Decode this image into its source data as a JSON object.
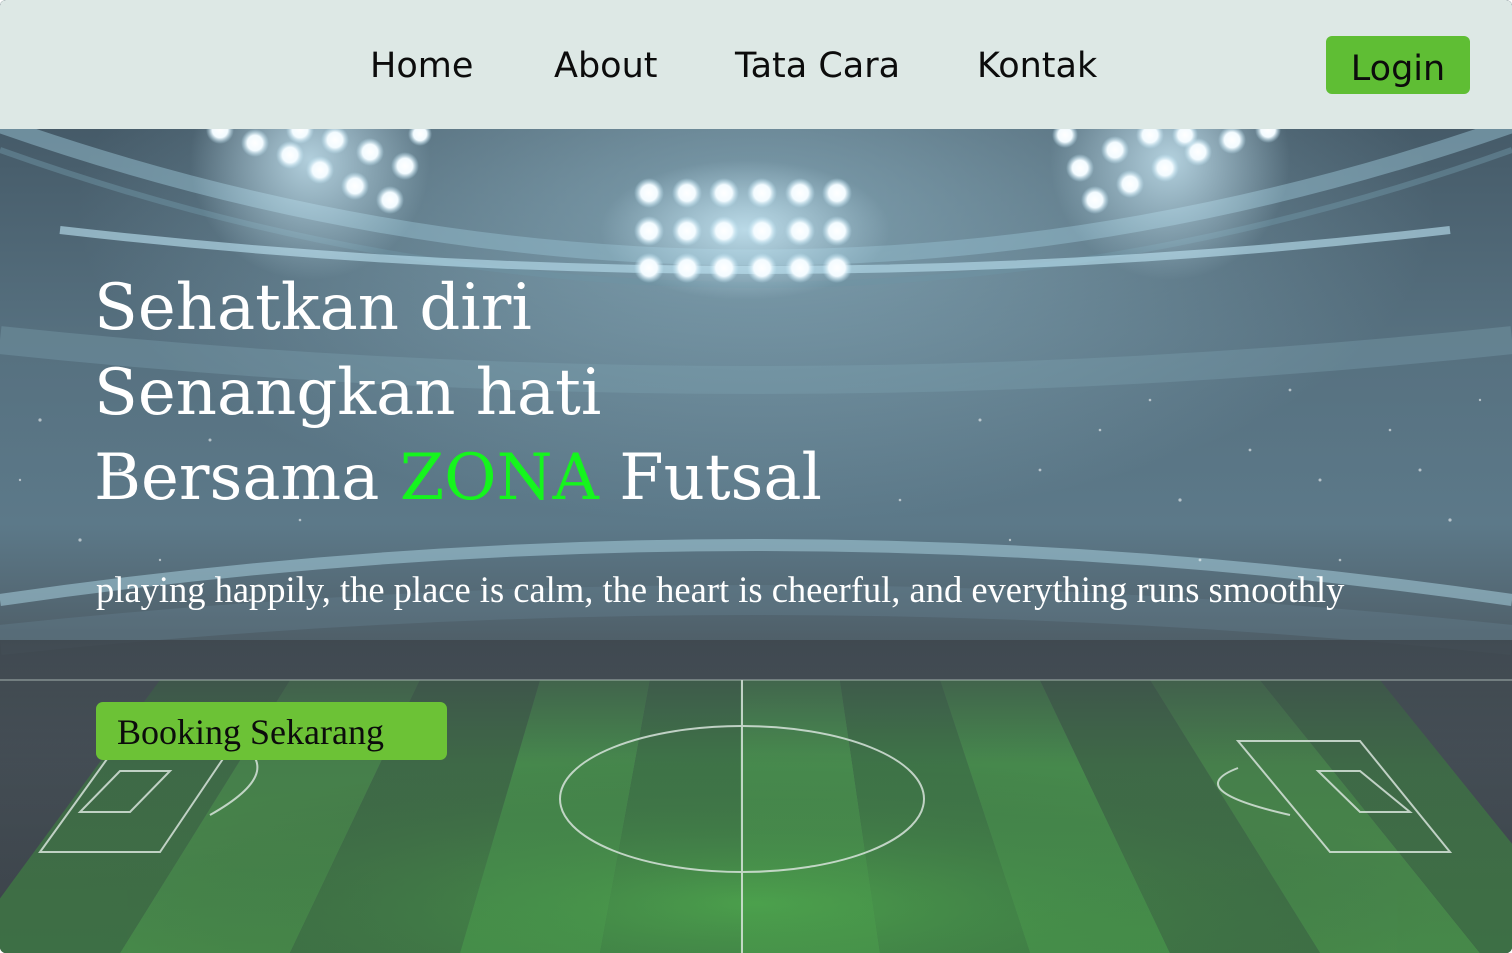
{
  "nav": {
    "links": [
      {
        "label": "Home"
      },
      {
        "label": "About"
      },
      {
        "label": "Tata Cara"
      },
      {
        "label": "Kontak"
      }
    ],
    "login_label": "Login"
  },
  "hero": {
    "headline": {
      "line1": "Sehatkan diri",
      "line2": "Senangkan hati",
      "line3_prefix": "Bersama ",
      "line3_accent": "ZONA",
      "line3_suffix": " Futsal"
    },
    "tagline": "playing happily, the place is calm, the heart is cheerful, and everything runs smoothly",
    "cta_label": "Booking Sekarang",
    "background_image": "futsal-stadium-illustration"
  },
  "colors": {
    "navbar_bg": "#dde8e5",
    "accent_green": "#15f51d",
    "button_green": "#5fbe34",
    "text_dark": "#0c0c0c",
    "text_light": "#ffffff"
  }
}
